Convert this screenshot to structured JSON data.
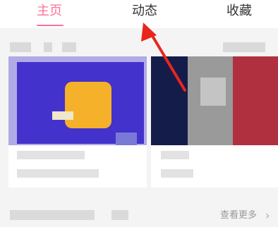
{
  "tabs": [
    {
      "label": "主页",
      "active": true
    },
    {
      "label": "动态",
      "active": false
    },
    {
      "label": "收藏",
      "active": false
    }
  ],
  "footer": {
    "see_more": "查看更多"
  },
  "colors": {
    "accent": "#fb7299",
    "annotation_arrow": "#e8261e"
  }
}
